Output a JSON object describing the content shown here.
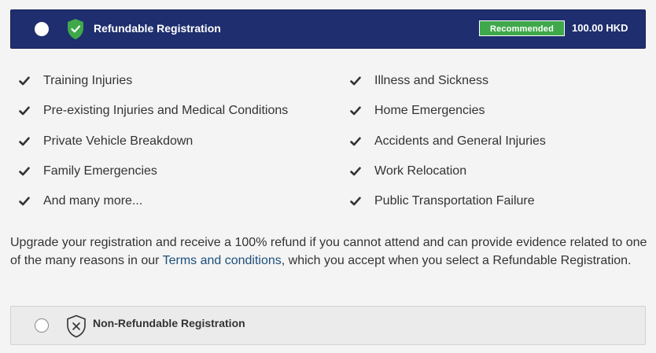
{
  "refundable": {
    "title": "Refundable Registration",
    "badge": "Recommended",
    "price": "100.00 HKD",
    "icon": "shield-check-icon",
    "colors": {
      "bar": "#1f2e6e",
      "badge": "#3fa84a",
      "shield": "#3fa84a"
    }
  },
  "features": {
    "left": [
      "Training Injuries",
      "Pre-existing Injuries and Medical Conditions",
      "Private Vehicle Breakdown",
      "Family Emergencies",
      "And many more..."
    ],
    "right": [
      "Illness and Sickness",
      "Home Emergencies",
      "Accidents and General Injuries",
      "Work Relocation",
      "Public Transportation Failure"
    ]
  },
  "description": {
    "before_link": "Upgrade your registration and receive a 100% refund if you cannot attend and can provide evidence related to one of the many reasons in our ",
    "link": "Terms and conditions",
    "after_link": ", which you accept when you select a Refundable Registration."
  },
  "non_refundable": {
    "title": "Non-Refundable Registration",
    "icon": "shield-x-icon"
  }
}
